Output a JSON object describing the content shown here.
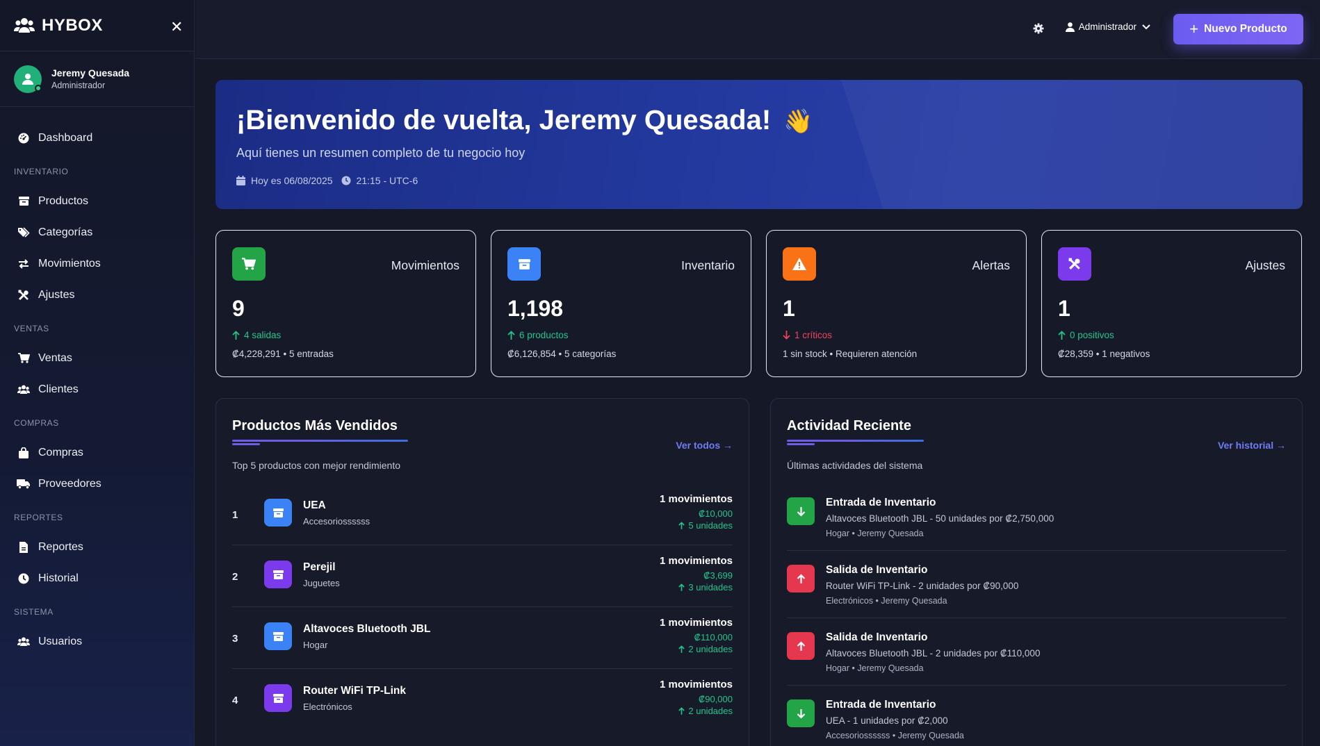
{
  "brand": {
    "name": "HYBOX"
  },
  "user": {
    "name": "Jeremy Quesada",
    "role": "Administrador"
  },
  "sidebar": {
    "dashboard": "Dashboard",
    "sections": {
      "inventario": "INVENTARIO",
      "ventas": "VENTAS",
      "compras": "COMPRAS",
      "reportes": "REPORTES",
      "sistema": "SISTEMA"
    },
    "items": {
      "productos": "Productos",
      "categorias": "Categorías",
      "movimientos": "Movimientos",
      "ajustes": "Ajustes",
      "ventas": "Ventas",
      "clientes": "Clientes",
      "compras": "Compras",
      "proveedores": "Proveedores",
      "reportes": "Reportes",
      "historial": "Historial",
      "usuarios": "Usuarios"
    }
  },
  "topbar": {
    "admin_label": "Administrador",
    "new_product": "Nuevo Producto"
  },
  "hero": {
    "title": "¡Bienvenido de vuelta, Jeremy Quesada!",
    "wave": "👋",
    "subtitle": "Aquí tienes un resumen completo de tu negocio hoy",
    "date": "Hoy es 06/08/2025",
    "time": "21:15 - UTC-6"
  },
  "stats": [
    {
      "title": "Movimientos",
      "value": "9",
      "trend": "4 salidas",
      "trend_dir": "up",
      "foot": "₡4,228,291 • 5 entradas",
      "color": "#22a447"
    },
    {
      "title": "Inventario",
      "value": "1,198",
      "trend": "6 productos",
      "trend_dir": "up",
      "foot": "₡6,126,854 • 5 categorías",
      "color": "#3b82f6"
    },
    {
      "title": "Alertas",
      "value": "1",
      "trend": "1 críticos",
      "trend_dir": "down",
      "foot": "1 sin stock • Requieren atención",
      "color": "#f97316"
    },
    {
      "title": "Ajustes",
      "value": "1",
      "trend": "0 positivos",
      "trend_dir": "up",
      "foot": "₡28,359 • 1 negativos",
      "color": "#7c3aed"
    }
  ],
  "top_products": {
    "title": "Productos Más Vendidos",
    "link": "Ver todos →",
    "subtitle": "Top 5 productos con mejor rendimiento",
    "items": [
      {
        "rank": "1",
        "name": "UEA",
        "category": "Accesoriossssss",
        "movements": "1 movimientos",
        "price": "₡10,000",
        "units": "5 unidades",
        "color": "#3b82f6"
      },
      {
        "rank": "2",
        "name": "Perejil",
        "category": "Juguetes",
        "movements": "1 movimientos",
        "price": "₡3,699",
        "units": "3 unidades",
        "color": "#7c3aed"
      },
      {
        "rank": "3",
        "name": "Altavoces Bluetooth JBL",
        "category": "Hogar",
        "movements": "1 movimientos",
        "price": "₡110,000",
        "units": "2 unidades",
        "color": "#3b82f6"
      },
      {
        "rank": "4",
        "name": "Router WiFi TP-Link",
        "category": "Electrónicos",
        "movements": "1 movimientos",
        "price": "₡90,000",
        "units": "2 unidades",
        "color": "#7c3aed"
      }
    ]
  },
  "activity": {
    "title": "Actividad Reciente",
    "link": "Ver historial →",
    "subtitle": "Últimas actividades del sistema",
    "items": [
      {
        "type": "in",
        "title": "Entrada de Inventario",
        "desc": "Altavoces Bluetooth JBL - 50 unidades por ₡2,750,000",
        "meta": "Hogar • Jeremy Quesada",
        "color": "#22a447"
      },
      {
        "type": "out",
        "title": "Salida de Inventario",
        "desc": "Router WiFi TP-Link - 2 unidades por ₡90,000",
        "meta": "Electrónicos • Jeremy Quesada",
        "color": "#e5384f"
      },
      {
        "type": "out",
        "title": "Salida de Inventario",
        "desc": "Altavoces Bluetooth JBL - 2 unidades por ₡110,000",
        "meta": "Hogar • Jeremy Quesada",
        "color": "#e5384f"
      },
      {
        "type": "in",
        "title": "Entrada de Inventario",
        "desc": "UEA - 1 unidades por ₡2,000",
        "meta": "Accesoriossssss • Jeremy Quesada",
        "color": "#22a447"
      }
    ]
  }
}
